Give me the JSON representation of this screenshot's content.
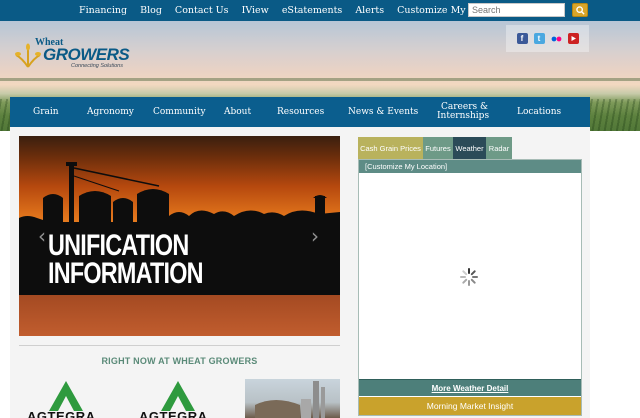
{
  "topbar": {
    "links": [
      "Financing",
      "Blog",
      "Contact Us",
      "IView",
      "eStatements",
      "Alerts",
      "Customize My Homepage"
    ],
    "search_placeholder": "Search"
  },
  "logo": {
    "line1": "Wheat",
    "line2": "GROWERS",
    "tagline": "Connecting Solutions"
  },
  "social": [
    "facebook-icon",
    "twitter-icon",
    "flickr-icon",
    "youtube-icon"
  ],
  "nav": {
    "items": [
      "Grain",
      "Agronomy",
      "Community",
      "About",
      "Resources",
      "News & Events",
      "Careers &",
      "Internships",
      "Locations"
    ]
  },
  "slider": {
    "title_line1": "UNIFICATION",
    "title_line2": "INFORMATION"
  },
  "section": {
    "heading": "RIGHT NOW AT WHEAT GROWERS",
    "promos": [
      "AGTEGRA",
      "AGTEGRA"
    ]
  },
  "weather": {
    "tabs": [
      "Cash Grain Prices",
      "Futures",
      "Weather",
      "Radar"
    ],
    "location_label": "[Customize My Location]",
    "more_label": "More Weather Detail",
    "insight_label": "Morning Market Insight"
  },
  "colors": {
    "primary_blue": "#0b5e8e",
    "teal": "#5e8c86",
    "gold": "#c9a22c",
    "olive_tab": "#b9b25d"
  }
}
